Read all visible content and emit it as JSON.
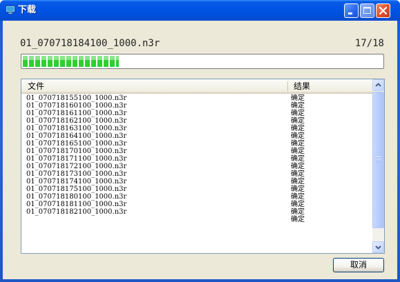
{
  "window": {
    "title": "下载",
    "accent": "#0054e3",
    "icons": [
      "app-icon",
      "minimize-icon",
      "maximize-icon",
      "close-icon"
    ]
  },
  "download": {
    "current_file": "01_070718184100_1000.n3r",
    "counter": "17/18",
    "progress": {
      "fill_fraction": 0.267,
      "color": "#2fcf2f"
    }
  },
  "list": {
    "columns": [
      "文件",
      "结果"
    ],
    "rows": [
      {
        "file": "01_070718155100_1000.n3r",
        "result": "确定"
      },
      {
        "file": "01_070718160100_1000.n3r",
        "result": "确定"
      },
      {
        "file": "01_070718161100_1000.n3r",
        "result": "确定"
      },
      {
        "file": "01_070718162100_1000.n3r",
        "result": "确定"
      },
      {
        "file": "01_070718163100_1000.n3r",
        "result": "确定"
      },
      {
        "file": "01_070718164100_1000.n3r",
        "result": "确定"
      },
      {
        "file": "01_070718165100_1000.n3r",
        "result": "确定"
      },
      {
        "file": "01_070718170100_1000.n3r",
        "result": "确定"
      },
      {
        "file": "01_070718171100_1000.n3r",
        "result": "确定"
      },
      {
        "file": "01_070718172100_1000.n3r",
        "result": "确定"
      },
      {
        "file": "01_070718173100_1000.n3r",
        "result": "确定"
      },
      {
        "file": "01_070718174100_1000.n3r",
        "result": "确定"
      },
      {
        "file": "01_070718175100_1000.n3r",
        "result": "确定"
      },
      {
        "file": "01_070718180100_1000.n3r",
        "result": "确定"
      },
      {
        "file": "01_070718181100_1000.n3r",
        "result": "确定"
      },
      {
        "file": "01_070718182100_1000.n3r",
        "result": "确定"
      },
      {
        "file": "",
        "result": "确定"
      }
    ]
  },
  "buttons": {
    "cancel_label": "取消"
  }
}
